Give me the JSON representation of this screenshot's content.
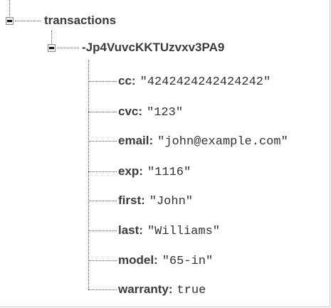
{
  "tree": {
    "root": {
      "key": "transactions",
      "child": {
        "key": "-Jp4VuvcKKTUzvxv3PA9",
        "fields": [
          {
            "key": "cc:",
            "value": "\"4242424242424242\""
          },
          {
            "key": "cvc:",
            "value": "\"123\""
          },
          {
            "key": "email:",
            "value": "\"john@example.com\""
          },
          {
            "key": "exp:",
            "value": "\"1116\""
          },
          {
            "key": "first:",
            "value": "\"John\""
          },
          {
            "key": "last:",
            "value": "\"Williams\""
          },
          {
            "key": "model:",
            "value": "\"65-in\""
          },
          {
            "key": "warranty:",
            "value": "true"
          }
        ]
      }
    }
  }
}
